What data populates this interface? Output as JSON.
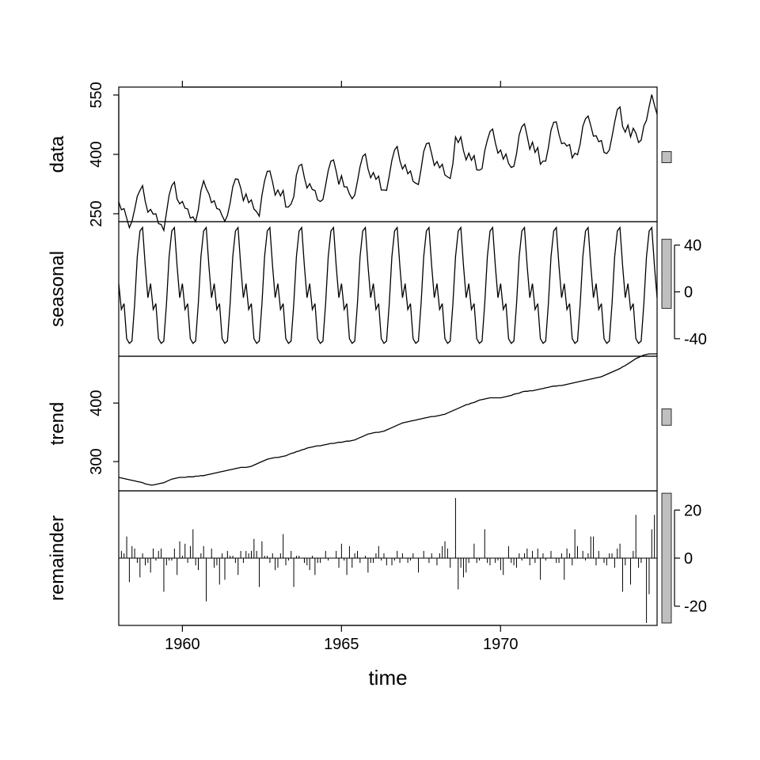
{
  "chart_data": {
    "type": "line",
    "title": "",
    "xlabel": "time",
    "x_start": 1958.0,
    "x_end": 1974.92,
    "x_ticks": [
      1960,
      1965,
      1970
    ],
    "panels": [
      {
        "name": "data",
        "side": "left",
        "ylim": [
          230,
          570
        ],
        "yticks": [
          250,
          400,
          550
        ],
        "range_bar": {
          "lo": 379,
          "hi": 407
        }
      },
      {
        "name": "seasonal",
        "side": "right",
        "ylim": [
          -55,
          60
        ],
        "yticks": [
          -40,
          0,
          40
        ],
        "range_bar": {
          "lo": -14,
          "hi": 45
        }
      },
      {
        "name": "trend",
        "side": "left",
        "ylim": [
          250,
          480
        ],
        "yticks": [
          300,
          400
        ],
        "range_bar": {
          "lo": 362,
          "hi": 390
        }
      },
      {
        "name": "remainder",
        "side": "right",
        "ylim": [
          -28,
          28
        ],
        "yticks": [
          -20,
          0,
          20
        ],
        "range_bar": {
          "lo": -27,
          "hi": 27
        }
      }
    ],
    "seasonal_cycle": [
      7,
      -15,
      -10,
      -40,
      -44,
      -42,
      -10,
      30,
      52,
      55,
      22,
      -5
    ],
    "trend_values": [
      273,
      272,
      271,
      270,
      269,
      268,
      267,
      266,
      265,
      264,
      262,
      261,
      260,
      260,
      261,
      262,
      263,
      264,
      266,
      268,
      270,
      271,
      272,
      273,
      273,
      273,
      274,
      274,
      274,
      275,
      275,
      276,
      276,
      277,
      278,
      279,
      280,
      281,
      282,
      283,
      284,
      285,
      286,
      287,
      288,
      289,
      290,
      290,
      290,
      291,
      292,
      294,
      296,
      298,
      300,
      302,
      304,
      305,
      306,
      307,
      307,
      308,
      309,
      310,
      312,
      314,
      315,
      317,
      318,
      320,
      321,
      323,
      324,
      325,
      326,
      327,
      327,
      328,
      329,
      330,
      331,
      331,
      332,
      333,
      333,
      334,
      335,
      335,
      336,
      337,
      339,
      341,
      343,
      345,
      347,
      348,
      349,
      350,
      350,
      351,
      352,
      354,
      356,
      358,
      360,
      362,
      364,
      366,
      367,
      368,
      369,
      370,
      371,
      372,
      373,
      374,
      375,
      376,
      377,
      377,
      378,
      379,
      380,
      381,
      383,
      385,
      387,
      389,
      391,
      393,
      395,
      397,
      398,
      400,
      401,
      403,
      405,
      406,
      407,
      408,
      409,
      409,
      409,
      409,
      409,
      410,
      411,
      412,
      413,
      415,
      416,
      417,
      419,
      420,
      420,
      421,
      421,
      422,
      423,
      424,
      425,
      426,
      427,
      428,
      429,
      429,
      430,
      430,
      431,
      432,
      433,
      434,
      435,
      436,
      437,
      438,
      439,
      440,
      441,
      442,
      443,
      444,
      445,
      447,
      449,
      451,
      453,
      455,
      457,
      459,
      462,
      464,
      467,
      470,
      473,
      476,
      478,
      480,
      482,
      483,
      484,
      484,
      484,
      484
    ],
    "remainder_values": [
      0,
      3,
      2,
      9,
      -10,
      5,
      4,
      -2,
      -8,
      2,
      -3,
      -2,
      -6,
      4,
      -1,
      3,
      4,
      -14,
      -3,
      -1,
      -1,
      4,
      -7,
      7,
      1,
      6,
      -2,
      5,
      12,
      -3,
      -5,
      2,
      5,
      -18,
      0,
      4,
      -4,
      -3,
      -11,
      2,
      -9,
      3,
      1,
      1,
      -2,
      -7,
      3,
      -2,
      3,
      2,
      3,
      8,
      3,
      -12,
      7,
      1,
      1,
      -2,
      2,
      -5,
      -4,
      2,
      10,
      -3,
      -1,
      3,
      -12,
      1,
      1,
      0,
      -2,
      -3,
      -5,
      1,
      -7,
      -2,
      -2,
      0,
      3,
      -1,
      0,
      0,
      3,
      -4,
      6,
      -1,
      -7,
      5,
      -4,
      2,
      3,
      -2,
      0,
      1,
      -6,
      -2,
      -2,
      2,
      5,
      -1,
      2,
      -3,
      0,
      -3,
      -1,
      3,
      -2,
      2,
      0,
      -2,
      -1,
      2,
      0,
      -6,
      0,
      3,
      0,
      -2,
      2,
      0,
      -3,
      2,
      5,
      7,
      4,
      -4,
      0,
      25,
      -13,
      -4,
      -8,
      -6,
      -2,
      0,
      6,
      -2,
      -1,
      0,
      12,
      -2,
      -3,
      0,
      -2,
      -1,
      -5,
      -7,
      0,
      5,
      -2,
      -3,
      -4,
      2,
      -1,
      2,
      4,
      -3,
      3,
      -2,
      4,
      -9,
      2,
      -1,
      0,
      3,
      0,
      -2,
      -2,
      2,
      -9,
      4,
      2,
      -3,
      12,
      5,
      0,
      3,
      -1,
      2,
      9,
      9,
      -3,
      3,
      0,
      -2,
      -3,
      2,
      2,
      -4,
      4,
      6,
      -14,
      -3,
      0,
      -11,
      3,
      18,
      -4,
      -2,
      0,
      -27,
      -15,
      12,
      18,
      22
    ]
  }
}
